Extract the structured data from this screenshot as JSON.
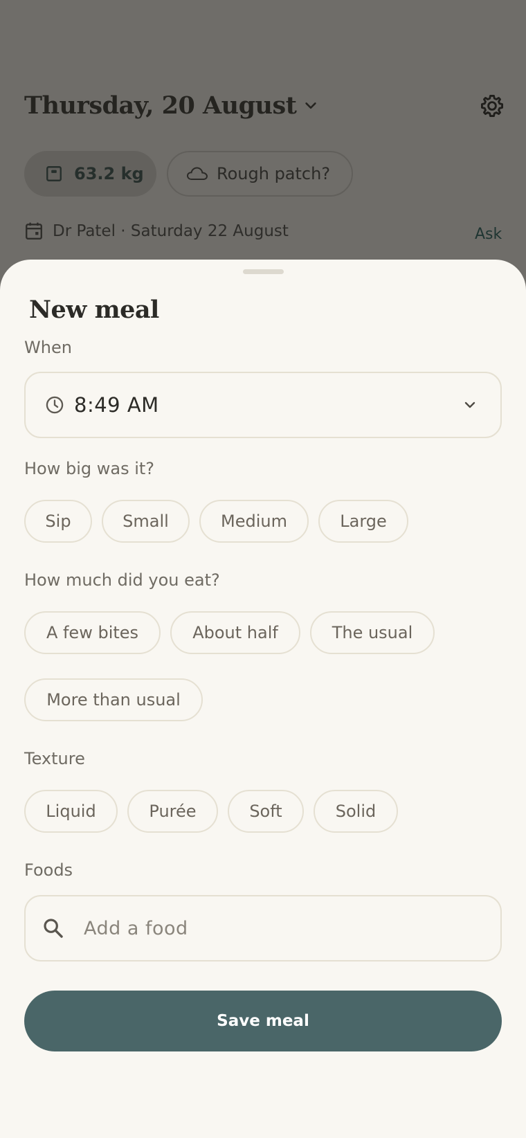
{
  "background": {
    "date_title": "Thursday, 20 August",
    "weight_chip": "63.2 kg",
    "mood_chip": "Rough patch?",
    "appointment": "Dr Patel · Saturday 22 August",
    "ask_link": "Ask",
    "icons": [
      "chevron-down-icon",
      "gear-icon",
      "scale-icon",
      "cloud-icon",
      "calendar-icon"
    ]
  },
  "sheet": {
    "title": "New meal",
    "when": {
      "label": "When",
      "value": "8:49 AM"
    },
    "size": {
      "label": "How big was it?",
      "options": [
        "Sip",
        "Small",
        "Medium",
        "Large"
      ]
    },
    "amount": {
      "label": "How much did you eat?",
      "options": [
        "A few bites",
        "About half",
        "The usual",
        "More than usual"
      ]
    },
    "texture": {
      "label": "Texture",
      "options": [
        "Liquid",
        "Purée",
        "Soft",
        "Solid"
      ]
    },
    "foods": {
      "label": "Foods",
      "placeholder": "Add a food"
    },
    "save_label": "Save meal"
  },
  "colors": {
    "sheet_background": "#f9f7f2",
    "scrim": "#6f6d69",
    "accent": "#4a6668",
    "chip_border": "#e5e0d2"
  }
}
